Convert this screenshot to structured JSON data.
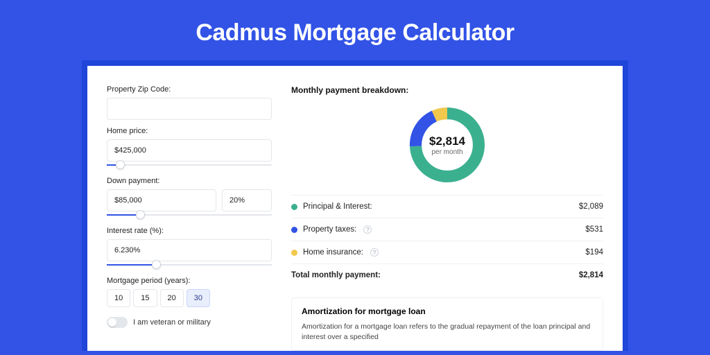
{
  "title": "Cadmus Mortgage Calculator",
  "form": {
    "zip_label": "Property Zip Code:",
    "zip_value": "",
    "price_label": "Home price:",
    "price_value": "$425,000",
    "price_slider_pct": 8,
    "down_label": "Down payment:",
    "down_value": "$85,000",
    "down_pct": "20%",
    "down_slider_pct": 20,
    "rate_label": "Interest rate (%):",
    "rate_value": "6.230%",
    "rate_slider_pct": 30,
    "period_label": "Mortgage period (years):",
    "periods": [
      "10",
      "15",
      "20",
      "30"
    ],
    "period_selected": "30",
    "veteran_label": "I am veteran or military",
    "veteran_on": false
  },
  "breakdown": {
    "title": "Monthly payment breakdown:",
    "center_amount": "$2,814",
    "center_sub": "per month",
    "items": [
      {
        "label": "Principal & Interest:",
        "value": "$2,089",
        "color": "green",
        "info": false,
        "fraction": 0.742
      },
      {
        "label": "Property taxes:",
        "value": "$531",
        "color": "blue",
        "info": true,
        "fraction": 0.189
      },
      {
        "label": "Home insurance:",
        "value": "$194",
        "color": "yellow",
        "info": true,
        "fraction": 0.069
      }
    ],
    "total_label": "Total monthly payment:",
    "total_value": "$2,814"
  },
  "amortization": {
    "title": "Amortization for mortgage loan",
    "body": "Amortization for a mortgage loan refers to the gradual repayment of the loan principal and interest over a specified"
  },
  "chart_data": {
    "type": "pie",
    "title": "Monthly payment breakdown",
    "series": [
      {
        "name": "Principal & Interest",
        "value": 2089
      },
      {
        "name": "Property taxes",
        "value": 531
      },
      {
        "name": "Home insurance",
        "value": 194
      }
    ],
    "total": 2814,
    "unit": "USD per month"
  }
}
